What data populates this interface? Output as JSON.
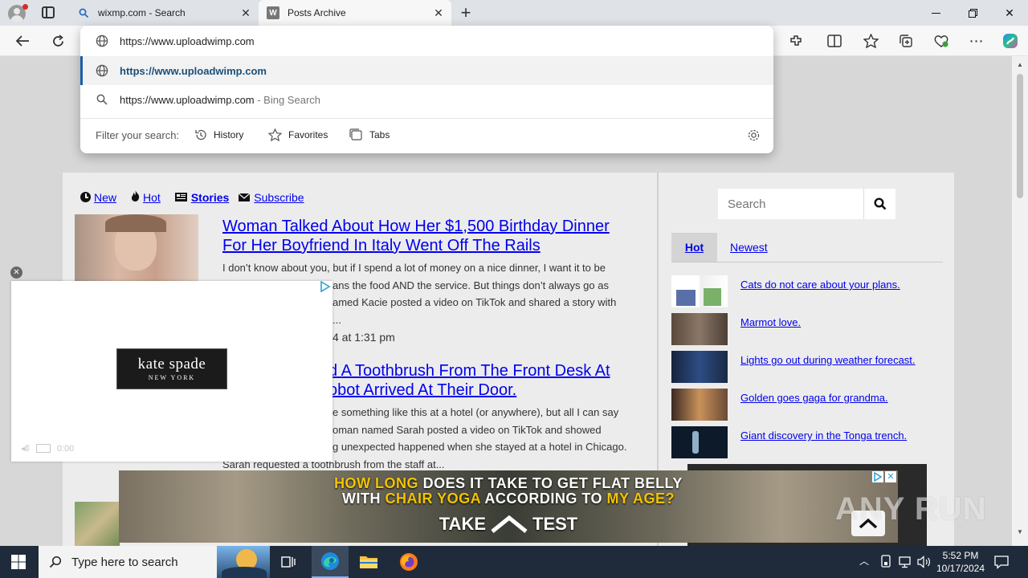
{
  "browser": {
    "tabs": [
      {
        "title": "wixmp.com - Search",
        "active": false
      },
      {
        "title": "Posts Archive",
        "active": true
      }
    ],
    "new_tab_label": "+",
    "window_controls": {
      "minimize": "—",
      "maximize": "❐",
      "close": "✕"
    }
  },
  "omnibox": {
    "input_value": "https://www.uploadwimp.com",
    "suggestions": [
      {
        "text": "https://www.uploadwimp.com",
        "kind": "url",
        "highlighted": true
      },
      {
        "text": "https://www.uploadwimp.com",
        "suffix": " - Bing Search",
        "kind": "search"
      }
    ],
    "filter_label": "Filter your search:",
    "filters": [
      "History",
      "Favorites",
      "Tabs"
    ]
  },
  "site": {
    "subnav": {
      "new": "New",
      "hot": "Hot",
      "stories": "Stories",
      "subscribe": "Subscribe"
    },
    "posts": [
      {
        "title_line1": "Woman Talked About How Her $1,500 Birthday Dinner",
        "title_line2": "For Her Boyfriend In Italy Went Off The Rails",
        "excerpt": [
          "I don’t know about you, but if I spend a lot of money on a nice dinner, I want it to be",
          "ans the food AND the service. But things don’t always go as",
          "amed Kacie posted a video on TikTok and shared a story with",
          "..."
        ],
        "date": "4 at 1:31 pm"
      },
      {
        "title_line1": "d A Toothbrush From The Front Desk At",
        "title_line2": "obot Arrived At Their Door.",
        "excerpt": [
          "e something like this at a hotel (or anywhere), but all I can say",
          "oman named Sarah posted a video on TikTok and showed",
          "g unexpected happened when she stayed at a hotel in Chicago.",
          "Sarah requested a toothbrush from the staff at..."
        ]
      }
    ],
    "sidebar": {
      "search_placeholder": "Search",
      "tabs": {
        "hot": "Hot",
        "newest": "Newest"
      },
      "items": [
        {
          "label": "Cats do not care about your plans."
        },
        {
          "label": "Marmot love."
        },
        {
          "label": "Lights go out during weather forecast."
        },
        {
          "label": "Golden goes gaga for grandma."
        },
        {
          "label": "Giant discovery in the Tonga trench."
        }
      ]
    }
  },
  "ads": {
    "popup_brand": "kate spade",
    "popup_brand_sub": "NEW YORK",
    "popup_timer": "0:00",
    "banner_line1_a": "HOW LONG",
    "banner_line1_b": " DOES IT TAKE TO GET FLAT BELLY",
    "banner_line2_a": "WITH ",
    "banner_line2_b": "CHAIR YOGA",
    "banner_line2_c": " ACCORDING TO ",
    "banner_line2_d": "MY AGE?",
    "banner_cta_a": "TAKE",
    "banner_cta_b": "TEST",
    "watermark": "ANY RUN"
  },
  "taskbar": {
    "search_placeholder": "Type here to search",
    "time": "5:52 PM",
    "date": "10/17/2024"
  },
  "colors": {
    "link": "#0000ee",
    "highlight_text": "#1a5fa8",
    "taskbar": "#1f2b3a",
    "ad_yellow": "#f3c400"
  }
}
